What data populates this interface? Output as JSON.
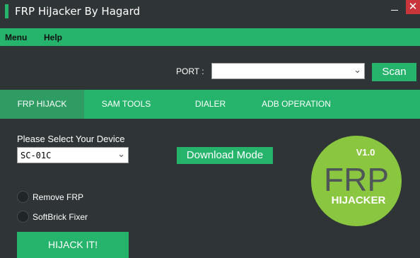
{
  "window": {
    "title": "FRP HiJacker By Hagard",
    "close_glyph": "✕"
  },
  "menu": [
    "Menu",
    "Help"
  ],
  "port": {
    "label": "PORT :",
    "value": "",
    "scan_label": "Scan"
  },
  "tabs": [
    {
      "label": "FRP HIJACK",
      "active": true
    },
    {
      "label": "SAM TOOLS",
      "active": false
    },
    {
      "label": "DIALER",
      "active": false
    },
    {
      "label": "ADB OPERATION",
      "active": false
    }
  ],
  "device": {
    "label": "Please Select Your Device",
    "selected": "SC-01C"
  },
  "download_mode_label": "Download Mode",
  "options": [
    {
      "label": "Remove FRP",
      "checked": false
    },
    {
      "label": "SoftBrick Fixer",
      "checked": false
    }
  ],
  "hijack_label": "HIJACK IT!",
  "logo": {
    "version": "V1.0",
    "main": "FRP",
    "sub": "HIJACKER"
  },
  "colors": {
    "accent": "#26b36b",
    "background": "#2f3537",
    "close": "#c8353a"
  }
}
